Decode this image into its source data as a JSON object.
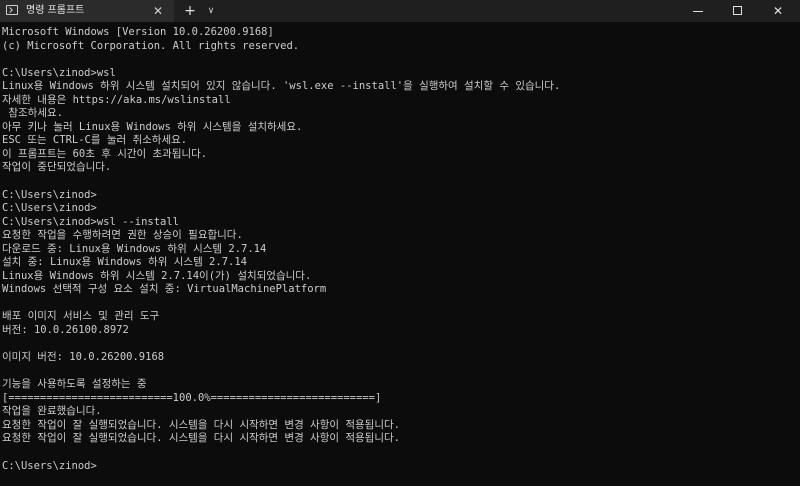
{
  "tab": {
    "title": "명령 프롬프트",
    "close_glyph": "✕",
    "new_tab_glyph": "+",
    "dropdown_glyph": "∨"
  },
  "window_controls": {
    "close_glyph": "✕"
  },
  "colors": {
    "background": "#0c0c0c",
    "foreground": "#cccccc",
    "titlebar": "#1f1f1f",
    "active_tab": "#2b2b2b"
  },
  "icons": {
    "tab": "terminal-icon",
    "new_tab": "plus-icon",
    "dropdown": "chevron-down-icon",
    "minimize": "minimize-icon",
    "maximize": "maximize-icon",
    "close": "close-icon"
  },
  "terminal": {
    "lines": [
      "Microsoft Windows [Version 10.0.26200.9168]",
      "(c) Microsoft Corporation. All rights reserved.",
      "",
      "C:\\Users\\zinod>wsl",
      "Linux용 Windows 하위 시스템 설치되어 있지 않습니다. 'wsl.exe --install'을 실행하여 설치할 수 있습니다.",
      "자세한 내용은 https://aka.ms/wslinstall",
      " 참조하세요.",
      "아무 키나 눌러 Linux용 Windows 하위 시스템을 설치하세요.",
      "ESC 또는 CTRL-C를 눌러 취소하세요.",
      "이 프롬프트는 60초 후 시간이 초과됩니다.",
      "작업이 중단되었습니다.",
      "",
      "C:\\Users\\zinod>",
      "C:\\Users\\zinod>",
      "C:\\Users\\zinod>wsl --install",
      "요청한 작업을 수행하려면 권한 상승이 필요합니다.",
      "다운로드 중: Linux용 Windows 하위 시스템 2.7.14",
      "설치 중: Linux용 Windows 하위 시스템 2.7.14",
      "Linux용 Windows 하위 시스템 2.7.14이(가) 설치되었습니다.",
      "Windows 선택적 구성 요소 설치 중: VirtualMachinePlatform",
      "",
      "배포 이미지 서비스 및 관리 도구",
      "버전: 10.0.26100.8972",
      "",
      "이미지 버전: 10.0.26200.9168",
      "",
      "기능을 사용하도록 설정하는 중",
      "[==========================100.0%==========================]",
      "작업을 완료했습니다.",
      "요청한 작업이 잘 실행되었습니다. 시스템을 다시 시작하면 변경 사항이 적용됩니다.",
      "요청한 작업이 잘 실행되었습니다. 시스템을 다시 시작하면 변경 사항이 적용됩니다.",
      "",
      "C:\\Users\\zinod>"
    ]
  }
}
